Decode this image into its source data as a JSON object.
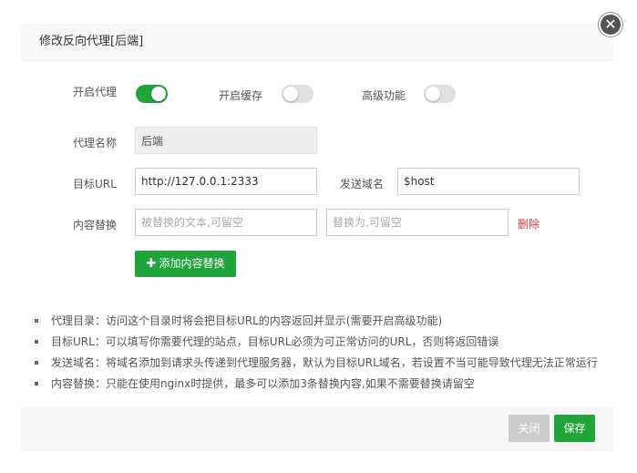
{
  "dialog": {
    "title": "修改反向代理[后端]",
    "close_glyph": "✕"
  },
  "switches": {
    "proxy": {
      "label": "开启代理",
      "on": true
    },
    "cache": {
      "label": "开启缓存",
      "on": false
    },
    "advanced": {
      "label": "高级功能",
      "on": false
    }
  },
  "form": {
    "proxy_name": {
      "label": "代理名称",
      "value": "后端"
    },
    "target_url": {
      "label": "目标URL",
      "value": "http://127.0.0.1:2333"
    },
    "send_domain": {
      "label": "发送域名",
      "value": "$host"
    },
    "content_replace": {
      "label": "内容替换",
      "from_placeholder": "被替换的文本,可留空",
      "to_placeholder": "替换为,可留空",
      "delete_label": "删除"
    },
    "add_replace_label": "添加内容替换",
    "add_icon": "plus-icon"
  },
  "tips": [
    "代理目录：访问这个目录时将会把目标URL的内容返回并显示(需要开启高级功能)",
    "目标URL：可以填写你需要代理的站点，目标URL必须为可正常访问的URL，否则将返回错误",
    "发送域名：将域名添加到请求头传递到代理服务器，默认为目标URL域名，若设置不当可能导致代理无法正常运行",
    "内容替换：只能在使用nginx时提供，最多可以添加3条替换内容,如果不需要替换请留空"
  ],
  "footer": {
    "close_label": "关闭",
    "save_label": "保存"
  },
  "colors": {
    "accent": "#20a53a",
    "danger": "#e4393c",
    "disabled": "#cbcbcb"
  }
}
